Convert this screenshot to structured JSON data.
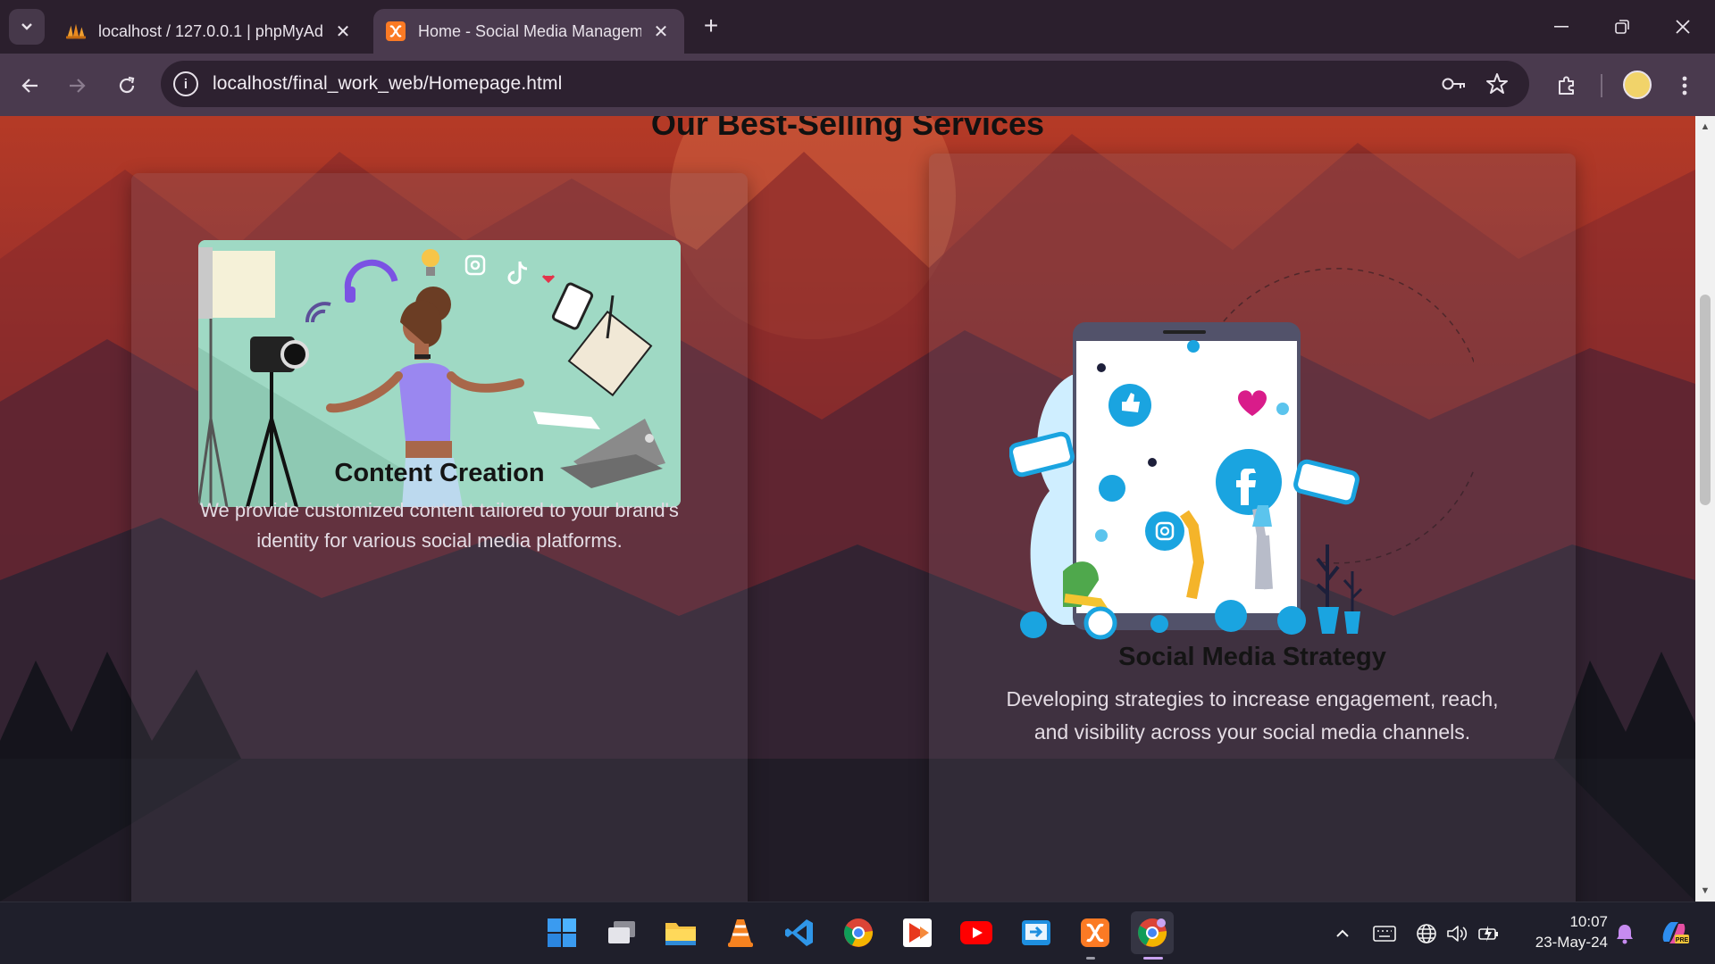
{
  "browser": {
    "tabs": [
      {
        "title": "localhost / 127.0.0.1 | phpMyAd",
        "icon": "phpmyadmin-icon",
        "active": false
      },
      {
        "title": "Home - Social Media Managem",
        "icon": "xampp-icon",
        "active": true
      }
    ],
    "url": "localhost/final_work_web/Homepage.html"
  },
  "page": {
    "heading": "Our Best-Selling Services",
    "services": [
      {
        "title": "Content Creation",
        "description_line1": "We provide customized content tailored to your brand's",
        "description_line2": "identity for various social media platforms."
      },
      {
        "title": "Social Media Strategy",
        "description_line1": "Developing strategies to increase engagement, reach,",
        "description_line2": "and visibility across your social media channels."
      }
    ]
  },
  "taskbar": {
    "apps": [
      "windows-start",
      "task-view",
      "file-explorer",
      "vlc",
      "vs-code",
      "chrome",
      "media-player",
      "youtube",
      "remote-app",
      "xampp",
      "chrome-active"
    ],
    "time": "10:07",
    "date": "23-May-24"
  },
  "colors": {
    "tab_bar": "#2b1f2d",
    "toolbar": "#4a3a4e",
    "heading_text": "#111111",
    "description_text": "#e4dce4",
    "taskbar": "#1f1f2b"
  }
}
